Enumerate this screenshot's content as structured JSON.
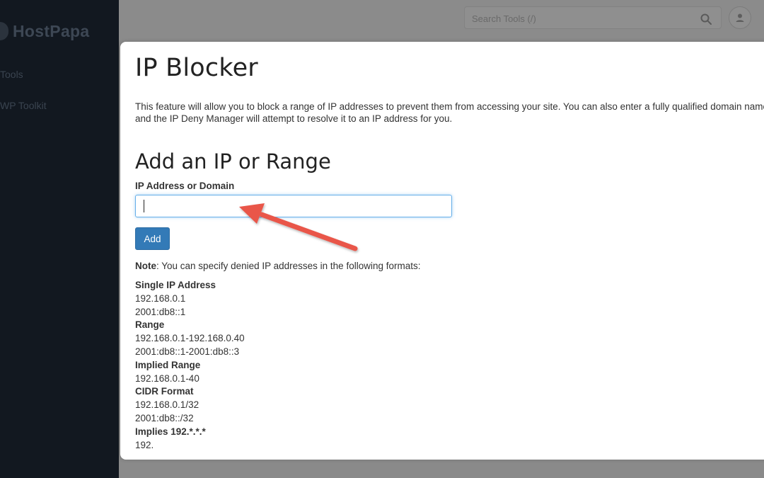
{
  "sidebar": {
    "brand": "HostPapa",
    "items": [
      {
        "label": "Tools"
      },
      {
        "label": "WP Toolkit"
      }
    ]
  },
  "header": {
    "search_placeholder": "Search Tools (/)"
  },
  "modal": {
    "title": "IP Blocker",
    "description_line1": "This feature will allow you to block a range of IP addresses to prevent them from accessing your site. You can also enter a fully qualified domain name,",
    "description_line2": "and the IP Deny Manager will attempt to resolve it to an IP address for you.",
    "section_title": "Add an IP or Range",
    "field_label": "IP Address or Domain",
    "field_value": "",
    "add_label": "Add",
    "note_label": "Note",
    "note_text": ": You can specify denied IP addresses in the following formats:",
    "formats": [
      {
        "header": "Single IP Address",
        "examples": [
          "192.168.0.1",
          "2001:db8::1"
        ]
      },
      {
        "header": "Range",
        "examples": [
          "192.168.0.1-192.168.0.40",
          "2001:db8::1-2001:db8::3"
        ]
      },
      {
        "header": "Implied Range",
        "examples": [
          "192.168.0.1-40"
        ]
      },
      {
        "header": "CIDR Format",
        "examples": [
          "192.168.0.1/32",
          "2001:db8::/32"
        ]
      },
      {
        "header": "Implies 192.*.*.*",
        "examples": [
          "192."
        ]
      }
    ]
  },
  "colors": {
    "primary_button": "#337ab7",
    "annotation_arrow": "#e9574a",
    "focus_border": "#66afe9"
  }
}
